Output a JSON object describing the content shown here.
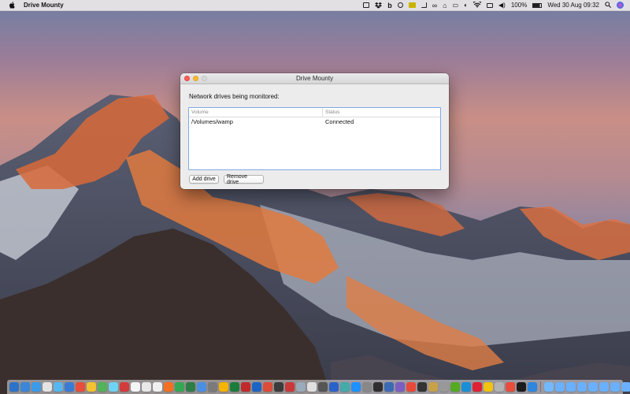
{
  "menubar": {
    "app_name": "Drive Mounty",
    "battery": "100%",
    "clock": "Wed 30 Aug  09:32",
    "icons": [
      "apple-icon",
      "drive-icon",
      "dropbox-icon",
      "b-icon",
      "bulb-icon",
      "folder-icon",
      "crop-icon",
      "infinity-icon",
      "home-icon",
      "text-icon",
      "sound-icon",
      "wifi-icon",
      "airplay-icon",
      "volume-icon",
      "battery-icon",
      "search-icon",
      "siri-icon"
    ]
  },
  "window": {
    "title": "Drive Mounty",
    "label": "Network drives being monitored:",
    "table": {
      "columns": [
        "Volume",
        "Status"
      ],
      "rows": [
        {
          "volume": "/Volumes/wamp",
          "status": "Connected"
        }
      ]
    },
    "buttons": {
      "add": "Add drive",
      "remove": "Remove drive"
    }
  },
  "dock": {
    "icon_colors": [
      "#2a73c8",
      "#3b86d6",
      "#3c9be8",
      "#e3e3e3",
      "#56b7f0",
      "#3a7bd5",
      "#e94e3c",
      "#f2c230",
      "#52b35a",
      "#6fd3f5",
      "#d23c3c",
      "#f5f5f5",
      "#e8e8e8",
      "#f0f0f0",
      "#f37021",
      "#34a853",
      "#2d7d46",
      "#4a90e2",
      "#7a7a7a",
      "#f4b400",
      "#1c7c3c",
      "#c02a2a",
      "#1b64c6",
      "#dd4b39",
      "#3b3b3b",
      "#c93939",
      "#9ab",
      "#e0e0e0",
      "#555",
      "#2a62c9",
      "#4aa",
      "#1e90ff",
      "#888",
      "#2f2f2f",
      "#3b6bb3",
      "#7a5ec2",
      "#e84a3a",
      "#333",
      "#c8a24a",
      "#999",
      "#5a2",
      "#1a8fd6",
      "#d23",
      "#f1c40f",
      "#b3b3b3",
      "#e74c3c",
      "#1c1c1c",
      "#2e86de",
      "#73b9ff",
      "#6ab0ff",
      "#6ab0ff",
      "#6ab0ff",
      "#6ab0ff",
      "#6ab0ff",
      "#6ab0ff",
      "#6ab0ff",
      "#6ab0ff",
      "#444"
    ]
  }
}
